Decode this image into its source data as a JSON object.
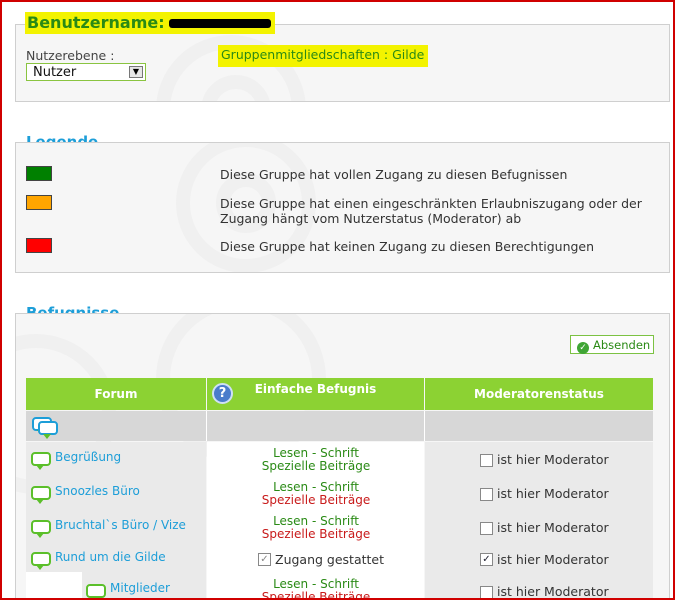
{
  "header": {
    "title_prefix": "Benutzername:",
    "level_label": "Nutzerebene :",
    "level_value": "Nutzer",
    "groups_text": "Gruppenmitgliedschaften : Gilde"
  },
  "legend": {
    "title": "Legende",
    "items": [
      {
        "color": "#008000",
        "text": "Diese Gruppe hat vollen Zugang zu diesen Befugnissen"
      },
      {
        "color": "#ffa500",
        "text": "Diese Gruppe hat einen eingeschränkten Erlaubniszugang oder der Zugang hängt vom Nutzerstatus (Moderator) ab"
      },
      {
        "color": "#ff0000",
        "text": "Diese Gruppe hat keinen Zugang zu diesen Berechtigungen"
      }
    ]
  },
  "permissions": {
    "title": "Befugnisse",
    "submit_label": "Absenden",
    "col_forum": "Forum",
    "col_simple": "Einfache Befugnis",
    "col_moderator": "Moderatorenstatus",
    "help_icon": "question-icon",
    "rows": [
      {
        "forum": "Begrüßung",
        "line1": "Lesen - Schrift",
        "line2": "Spezielle Beiträge",
        "line2_color": "green",
        "mod_label": "ist hier Moderator",
        "mod_checked": false
      },
      {
        "forum": "Snoozles Büro",
        "line1": "Lesen - Schrift",
        "line2": "Spezielle Beiträge",
        "line2_color": "red",
        "mod_label": "ist hier Moderator",
        "mod_checked": false
      },
      {
        "forum": "Bruchtal`s Büro / Vize",
        "line1": "Lesen - Schrift",
        "line2": "Spezielle Beiträge",
        "line2_color": "red",
        "mod_label": "ist hier Moderator",
        "mod_checked": false
      },
      {
        "forum": "Rund um die Gilde",
        "access_label": "Zugang gestattet",
        "mod_label": "ist hier Moderator",
        "mod_checked": true
      },
      {
        "forum": "Mitglieder",
        "line1": "Lesen - Schrift",
        "line2": "Spezielle Beiträge",
        "line2_color": "red",
        "mod_label": "ist hier Moderator",
        "mod_checked": false
      }
    ]
  },
  "colors": {
    "accent_green": "#8cd233",
    "title_blue": "#1d9ed8",
    "highlight_yellow": "#f3f300",
    "frame_red": "#d00000"
  }
}
